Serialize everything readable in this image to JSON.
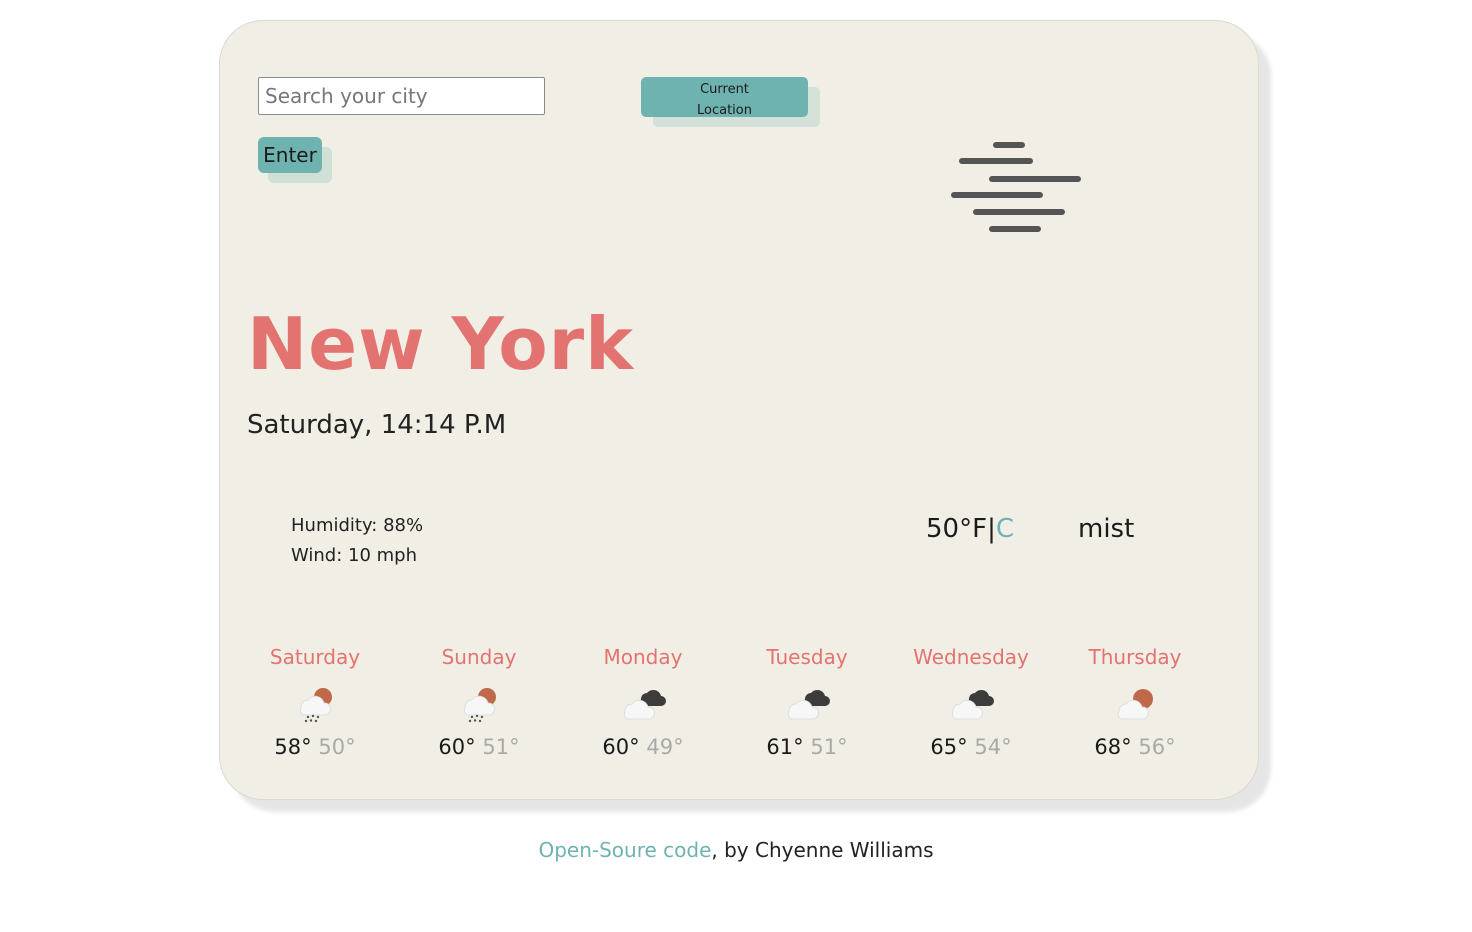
{
  "search": {
    "placeholder": "Search your city",
    "value": ""
  },
  "buttons": {
    "enter_label": "Enter",
    "current_location_label": "Current Location"
  },
  "current": {
    "icon": "mist-icon",
    "city": "New York",
    "datetime": "Saturday, 14:14 P.M",
    "humidity": "Humidity: 88%",
    "wind": "Wind: 10 mph",
    "temperature": "50",
    "unit_f": "°F",
    "unit_separator": "|",
    "unit_c": "C",
    "description": "mist"
  },
  "forecast": [
    {
      "day": "Saturday",
      "icon": "rain-cloud-sun-icon",
      "max": "58°",
      "min": "50°"
    },
    {
      "day": "Sunday",
      "icon": "rain-cloud-sun-icon",
      "max": "60°",
      "min": "51°"
    },
    {
      "day": "Monday",
      "icon": "broken-clouds-icon",
      "max": "60°",
      "min": "49°"
    },
    {
      "day": "Tuesday",
      "icon": "broken-clouds-icon",
      "max": "61°",
      "min": "51°"
    },
    {
      "day": "Wednesday",
      "icon": "broken-clouds-icon",
      "max": "65°",
      "min": "54°"
    },
    {
      "day": "Thursday",
      "icon": "cloud-sun-icon",
      "max": "68°",
      "min": "56°"
    }
  ],
  "footer": {
    "link_text": "Open-Soure code",
    "suffix": ", by Chyenne Williams"
  },
  "colors": {
    "accent": "#6fb3b0",
    "city": "#e37371",
    "card_background": "#f1efe5"
  }
}
